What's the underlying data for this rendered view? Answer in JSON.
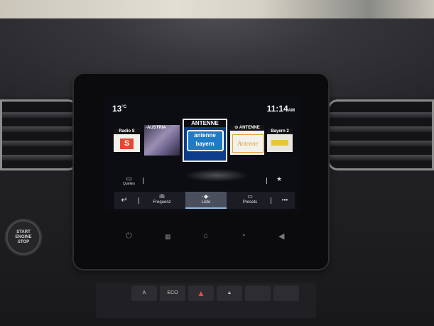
{
  "status_bar": {
    "temperature": "13",
    "temperature_unit": "°C",
    "time": "11:14",
    "time_suffix": "AM"
  },
  "stations": [
    {
      "header": "Radio S",
      "logo_text": "S"
    },
    {
      "header": "-AUSTRIA",
      "logo_text": ""
    },
    {
      "header": "ANTENNE",
      "logo_line1": "antenne",
      "logo_line2": "bayern",
      "selected": true
    },
    {
      "header": "ANTENNE",
      "logo_text": "Antenne"
    },
    {
      "header": "Bayern 2",
      "logo_text": ""
    }
  ],
  "mid_row": {
    "sources_label": "Quellen",
    "sources_icon": "folder-icon",
    "favorite_icon": "star-icon"
  },
  "bottom_bar": [
    {
      "label": "",
      "icon": "back-arrow-icon"
    },
    {
      "label": "Frequenz",
      "icon": "frequency-icon"
    },
    {
      "label": "Liste",
      "icon": "list-icon",
      "active": true
    },
    {
      "label": "Presets",
      "icon": "folder-icon"
    },
    {
      "label": "",
      "icon": "more-icon"
    }
  ],
  "hardware_buttons": [
    "power-icon",
    "apps-icon",
    "home-icon",
    "voice-icon",
    "volume-icon"
  ],
  "car": {
    "start_button": "START\nENGINE\nSTOP",
    "eco_label": "ECO",
    "auto_label": "A"
  },
  "colors": {
    "accent_blue": "#0d3d8a",
    "active_tab": "#4a4f5e",
    "hazard": "#e24b4b"
  }
}
